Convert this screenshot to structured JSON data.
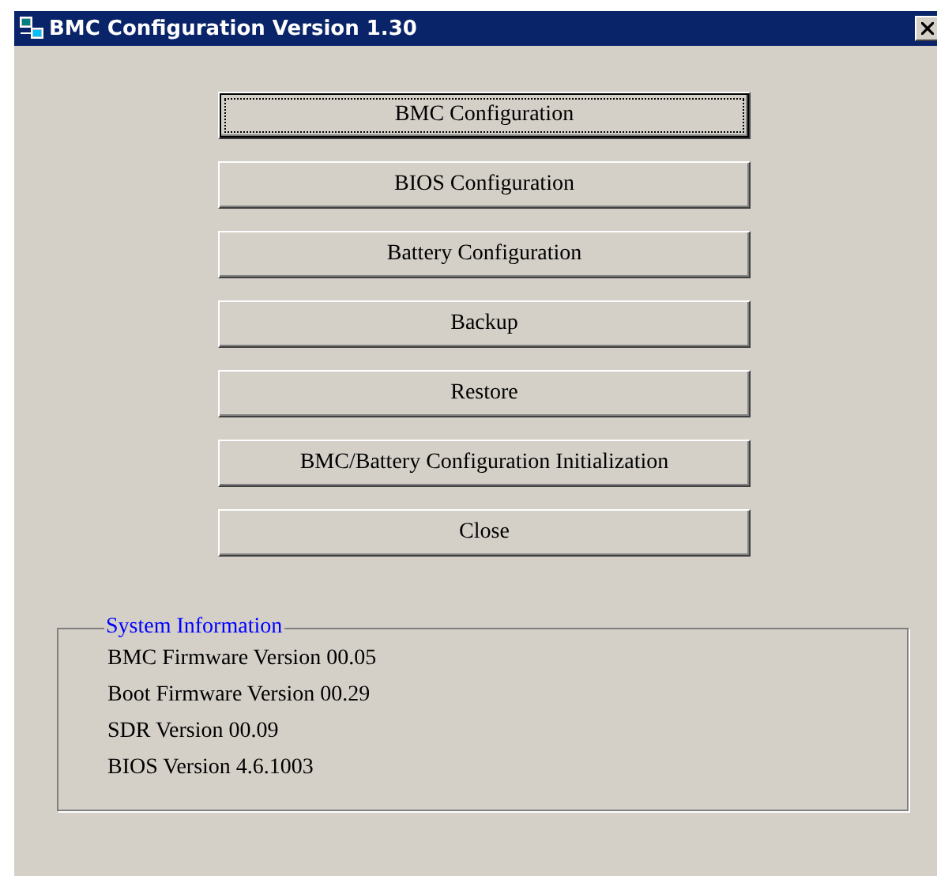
{
  "window": {
    "title": "BMC Configuration Version 1.30"
  },
  "buttons": [
    {
      "label": "BMC Configuration",
      "focused": true
    },
    {
      "label": "BIOS Configuration",
      "focused": false
    },
    {
      "label": "Battery Configuration",
      "focused": false
    },
    {
      "label": "Backup",
      "focused": false
    },
    {
      "label": "Restore",
      "focused": false
    },
    {
      "label": "BMC/Battery Configuration Initialization",
      "focused": false
    },
    {
      "label": "Close",
      "focused": false
    }
  ],
  "system_information": {
    "title": "System Information",
    "lines": [
      "BMC Firmware Version 00.05",
      "Boot Firmware Version 00.29",
      "SDR Version 00.09",
      "BIOS Version 4.6.1003"
    ]
  }
}
